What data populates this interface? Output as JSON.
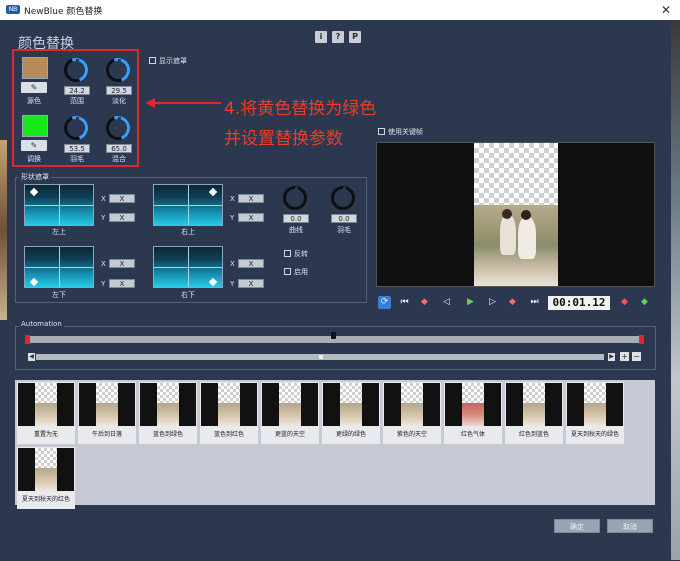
{
  "window": {
    "title": "NewBlue 颜色替换",
    "logo": "NB",
    "close_glyph": "✕"
  },
  "panel": {
    "title": "颜色替换"
  },
  "top_buttons": [
    "i",
    "?",
    "P"
  ],
  "show_mask": {
    "label": "显示遮罩"
  },
  "use_keyframes": {
    "label": "使用关键帧"
  },
  "source": {
    "swatch_color": "#b98c57",
    "label": "源色",
    "range": {
      "value": "24.2",
      "label": "范围"
    },
    "fade": {
      "value": "29.5",
      "label": "淡化"
    }
  },
  "replace": {
    "swatch_color": "#19e81c",
    "label": "调换",
    "feather": {
      "value": "53.5",
      "label": "羽毛"
    },
    "mix": {
      "value": "65.0",
      "label": "混合"
    }
  },
  "annotation": {
    "line1": "4.将黄色替换为绿色",
    "line2": "并设置替换参数"
  },
  "shape_mask": {
    "title": "形状遮罩",
    "pads": [
      {
        "label": "左上",
        "x": "X",
        "y": "X"
      },
      {
        "label": "右上",
        "x": "X",
        "y": "X"
      },
      {
        "label": "左下",
        "x": "X",
        "y": "X"
      },
      {
        "label": "右下",
        "x": "X",
        "y": "X"
      }
    ],
    "axis_x": "X",
    "axis_y": "Y",
    "curve": {
      "value": "0.0",
      "label": "曲线"
    },
    "feather": {
      "value": "0.0",
      "label": "羽毛"
    },
    "invert": {
      "label": "反转"
    },
    "enable": {
      "label": "启用"
    }
  },
  "transport": {
    "timecode": "00:01.12",
    "buttons": [
      "loop-icon",
      "go-start-icon",
      "prev-keyframe-icon",
      "step-back-icon",
      "play-icon",
      "step-forward-icon",
      "next-keyframe-icon",
      "go-end-icon"
    ]
  },
  "automation": {
    "label": "Automation"
  },
  "presets": [
    "重置为无",
    "午后到日落",
    "蓝色到绿色",
    "蓝色到红色",
    "更蓝的天空",
    "更绿的绿色",
    "紫色的天空",
    "红色气体",
    "红色到蓝色",
    "夏天到秋天的绿色",
    "夏天到秋天的红色"
  ],
  "dialog": {
    "ok": "确定",
    "cancel": "取消"
  },
  "colors": {
    "accent": "#3aa0ff",
    "annotation_red": "#e0282c",
    "window_bg": "#2b3850"
  }
}
